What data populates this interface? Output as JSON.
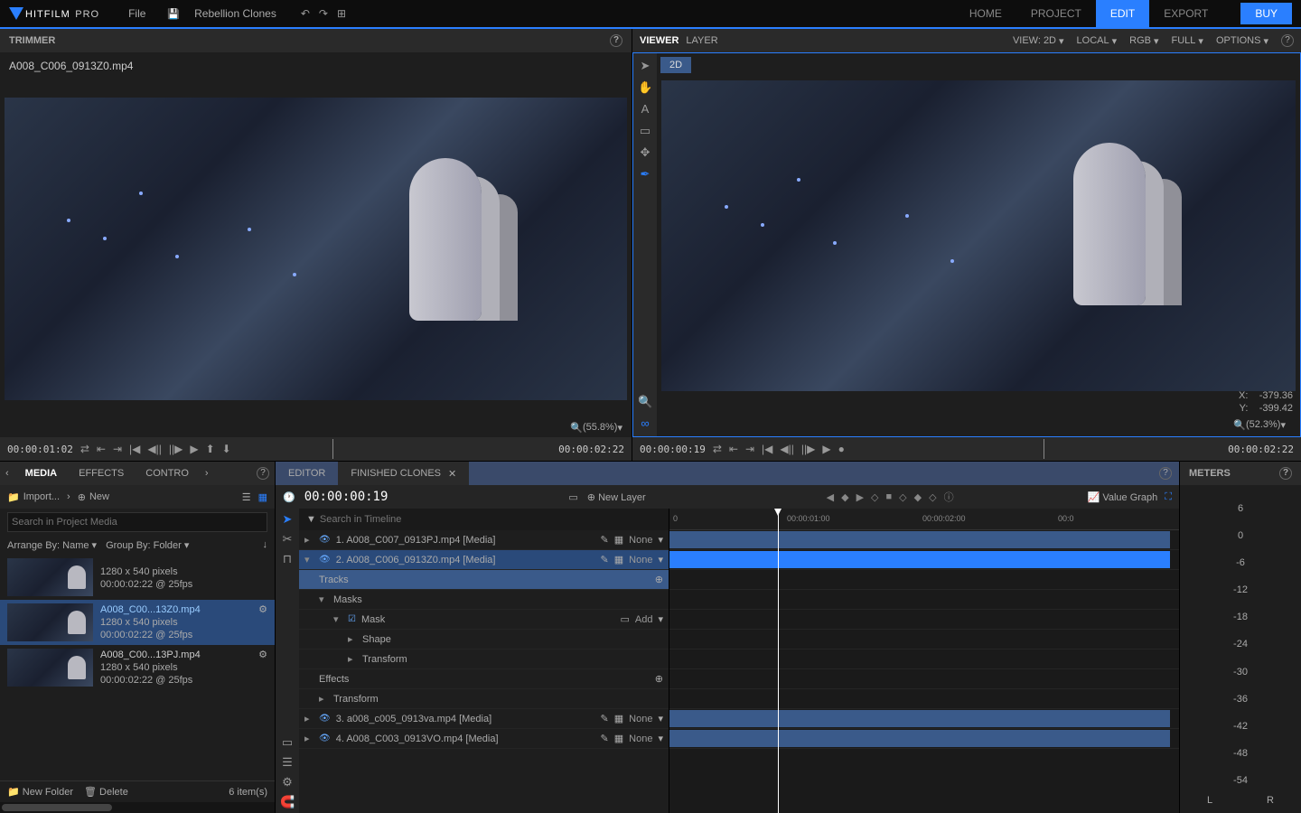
{
  "app": {
    "name_a": "HITFILM",
    "name_b": "PRO"
  },
  "menu": {
    "file": "File",
    "project": "Rebellion Clones"
  },
  "top_tabs": {
    "home": "HOME",
    "project": "PROJECT",
    "edit": "EDIT",
    "export": "EXPORT"
  },
  "buy": "BUY",
  "trimmer": {
    "title": "TRIMMER",
    "clip": "A008_C006_0913Z0.mp4",
    "zoom": "(55.8%)",
    "tc_in": "00:00:01:02",
    "tc_out": "00:00:02:22"
  },
  "viewer": {
    "title": "VIEWER",
    "layer": "LAYER",
    "view_label": "VIEW:",
    "view_mode": "2D",
    "local": "LOCAL",
    "rgb": "RGB",
    "full": "FULL",
    "options": "OPTIONS",
    "tab": "2D",
    "x_label": "X:",
    "x_val": "-379.36",
    "y_label": "Y:",
    "y_val": "-399.42",
    "zoom": "(52.3%)",
    "tc_in": "00:00:00:19",
    "tc_out": "00:00:02:22"
  },
  "media": {
    "tab_media": "MEDIA",
    "tab_effects": "EFFECTS",
    "tab_contro": "CONTRO",
    "import": "Import...",
    "new": "New",
    "search_ph": "Search in Project Media",
    "arrange": "Arrange By: Name",
    "group": "Group By: Folder",
    "items": [
      {
        "name": "",
        "dim": "1280 x 540 pixels",
        "dur": "00:00:02:22 @ 25fps"
      },
      {
        "name": "A008_C00...13Z0.mp4",
        "dim": "1280 x 540 pixels",
        "dur": "00:00:02:22 @ 25fps"
      },
      {
        "name": "A008_C00...13PJ.mp4",
        "dim": "1280 x 540 pixels",
        "dur": "00:00:02:22 @ 25fps"
      }
    ],
    "new_folder": "New Folder",
    "delete": "Delete",
    "count": "6 item(s)"
  },
  "editor": {
    "tab_editor": "EDITOR",
    "tab_finished": "FINISHED CLONES",
    "tc": "00:00:00:19",
    "new_layer": "New Layer",
    "value_graph": "Value Graph",
    "search_ph": "Search in Timeline",
    "ruler": {
      "t0": "0",
      "t1": "00:00:01:00",
      "t2": "00:00:02:00",
      "t3": "00:0"
    },
    "layers": [
      {
        "name": "1. A008_C007_0913PJ.mp4 [Media]",
        "blend": "None"
      },
      {
        "name": "2. A008_C006_0913Z0.mp4 [Media]",
        "blend": "None"
      },
      {
        "name": "Tracks"
      },
      {
        "name": "Masks"
      },
      {
        "name": "Mask",
        "action": "Add"
      },
      {
        "name": "Shape"
      },
      {
        "name": "Transform"
      },
      {
        "name": "Effects"
      },
      {
        "name": "Transform"
      },
      {
        "name": "3. a008_c005_0913va.mp4 [Media]",
        "blend": "None"
      },
      {
        "name": "4. A008_C003_0913VO.mp4 [Media]",
        "blend": "None"
      }
    ]
  },
  "meters": {
    "title": "METERS",
    "scale": [
      "6",
      "0",
      "-6",
      "-12",
      "-18",
      "-24",
      "-30",
      "-36",
      "-42",
      "-48",
      "-54"
    ],
    "l": "L",
    "r": "R"
  }
}
